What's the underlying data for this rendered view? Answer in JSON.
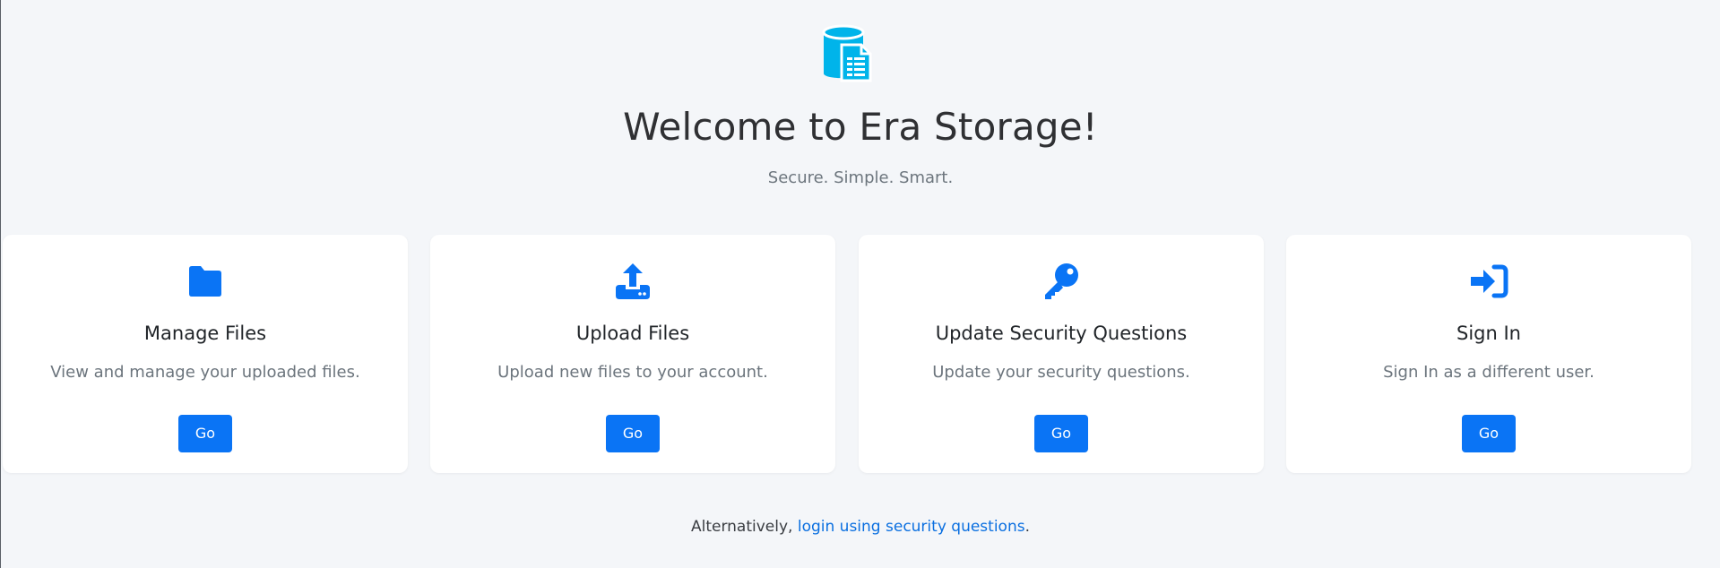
{
  "header": {
    "logo_icon": "storage-database-document-icon",
    "title": "Welcome to Era Storage!",
    "subtitle": "Secure. Simple. Smart."
  },
  "colors": {
    "accent": "#0a74f5",
    "logo": "#00b4ea",
    "background": "#f4f6f9"
  },
  "cards": [
    {
      "icon": "folder-icon",
      "title": "Manage Files",
      "description": "View and manage your uploaded files.",
      "button_label": "Go"
    },
    {
      "icon": "upload-icon",
      "title": "Upload Files",
      "description": "Upload new files to your account.",
      "button_label": "Go"
    },
    {
      "icon": "key-icon",
      "title": "Update Security Questions",
      "description": "Update your security questions.",
      "button_label": "Go"
    },
    {
      "icon": "sign-in-icon",
      "title": "Sign In",
      "description": "Sign In as a different user.",
      "button_label": "Go"
    }
  ],
  "footer": {
    "prefix": "Alternatively,",
    "link_text": "login using security questions",
    "suffix": "."
  }
}
